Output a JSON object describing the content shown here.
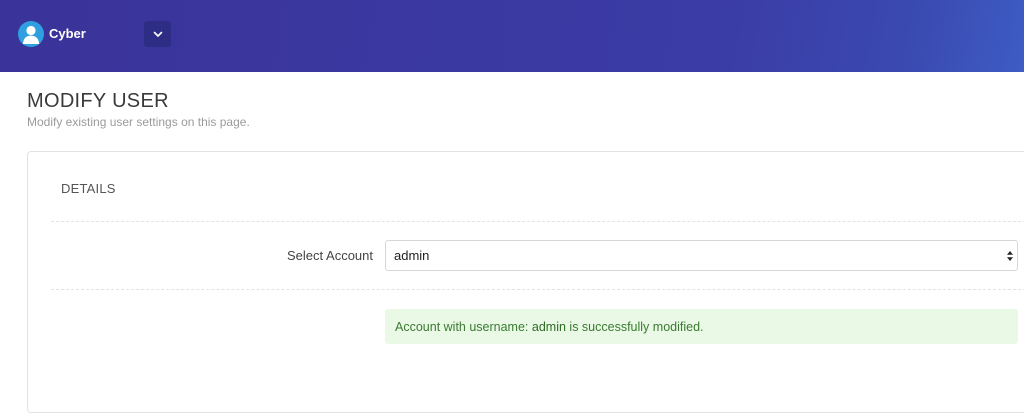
{
  "header": {
    "brand": "Cyber",
    "toggle_icon": "chevron-down-icon",
    "avatar_icon": "user-avatar-icon",
    "colors": {
      "bar": "#3b3ca6",
      "avatar": "#2f9fe0",
      "toggle": "#2e2d86"
    }
  },
  "page": {
    "title": "MODIFY USER",
    "subtitle": "Modify existing user settings on this page."
  },
  "card": {
    "title": "DETAILS",
    "form": {
      "select_label": "Select Account",
      "select_value": "admin",
      "select_icon": "select-arrows-icon"
    },
    "alert": {
      "prefix": "Account with username:",
      "username": "admin",
      "suffix": "is successfully modified.",
      "color_bg": "#e9f9e6",
      "color_text": "#3b7a31"
    }
  }
}
